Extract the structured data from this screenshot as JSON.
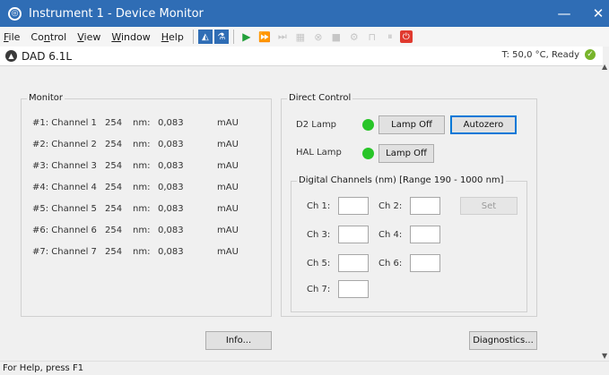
{
  "window": {
    "app_icon": "instrument-logo-icon",
    "title": "Instrument 1 - Device Monitor",
    "minimize_glyph": "—",
    "close_glyph": "✕"
  },
  "menu": [
    {
      "key": "file",
      "label": "File"
    },
    {
      "key": "control",
      "label": "Control"
    },
    {
      "key": "view",
      "label": "View"
    },
    {
      "key": "window",
      "label": "Window"
    },
    {
      "key": "help",
      "label": "Help"
    }
  ],
  "toolbar": {
    "icons": [
      "sequence-icon",
      "method-icon",
      "play-icon",
      "fast-forward-icon",
      "skip-icon",
      "sampler-icon",
      "stop-circle-icon",
      "stop-icon",
      "valve-icon",
      "wash-icon",
      "pause-icon",
      "power-icon"
    ]
  },
  "device": {
    "name": "DAD 6.1L",
    "status": "T: 50,0 °C, Ready",
    "status_icon": "ok-check-icon"
  },
  "monitor": {
    "title": "Monitor",
    "channels": [
      {
        "name": "#1: Channel 1",
        "wavelength": "254",
        "wl_unit": "nm:",
        "value": "0,083",
        "value_unit": "mAU"
      },
      {
        "name": "#2: Channel 2",
        "wavelength": "254",
        "wl_unit": "nm:",
        "value": "0,083",
        "value_unit": "mAU"
      },
      {
        "name": "#3: Channel 3",
        "wavelength": "254",
        "wl_unit": "nm:",
        "value": "0,083",
        "value_unit": "mAU"
      },
      {
        "name": "#4: Channel 4",
        "wavelength": "254",
        "wl_unit": "nm:",
        "value": "0,083",
        "value_unit": "mAU"
      },
      {
        "name": "#5: Channel 5",
        "wavelength": "254",
        "wl_unit": "nm:",
        "value": "0,083",
        "value_unit": "mAU"
      },
      {
        "name": "#6: Channel 6",
        "wavelength": "254",
        "wl_unit": "nm:",
        "value": "0,083",
        "value_unit": "mAU"
      },
      {
        "name": "#7: Channel 7",
        "wavelength": "254",
        "wl_unit": "nm:",
        "value": "0,083",
        "value_unit": "mAU"
      }
    ],
    "info_button": "Info..."
  },
  "direct_control": {
    "title": "Direct Control",
    "d2_lamp": {
      "label": "D2 Lamp",
      "state_color": "#28c528",
      "button": "Lamp Off"
    },
    "autozero_button": "Autozero",
    "hal_lamp": {
      "label": "HAL Lamp",
      "state_color": "#28c528",
      "button": "Lamp Off"
    },
    "digital": {
      "title": "Digital Channels (nm) [Range 190 - 1000 nm]",
      "ch1": {
        "label": "Ch 1:",
        "value": ""
      },
      "ch2": {
        "label": "Ch 2:",
        "value": ""
      },
      "ch3": {
        "label": "Ch 3:",
        "value": ""
      },
      "ch4": {
        "label": "Ch 4:",
        "value": ""
      },
      "ch5": {
        "label": "Ch 5:",
        "value": ""
      },
      "ch6": {
        "label": "Ch 6:",
        "value": ""
      },
      "ch7": {
        "label": "Ch 7:",
        "value": ""
      },
      "set_button": "Set"
    },
    "diagnostics_button": "Diagnostics..."
  },
  "statusbar": {
    "text": "For Help, press F1"
  }
}
